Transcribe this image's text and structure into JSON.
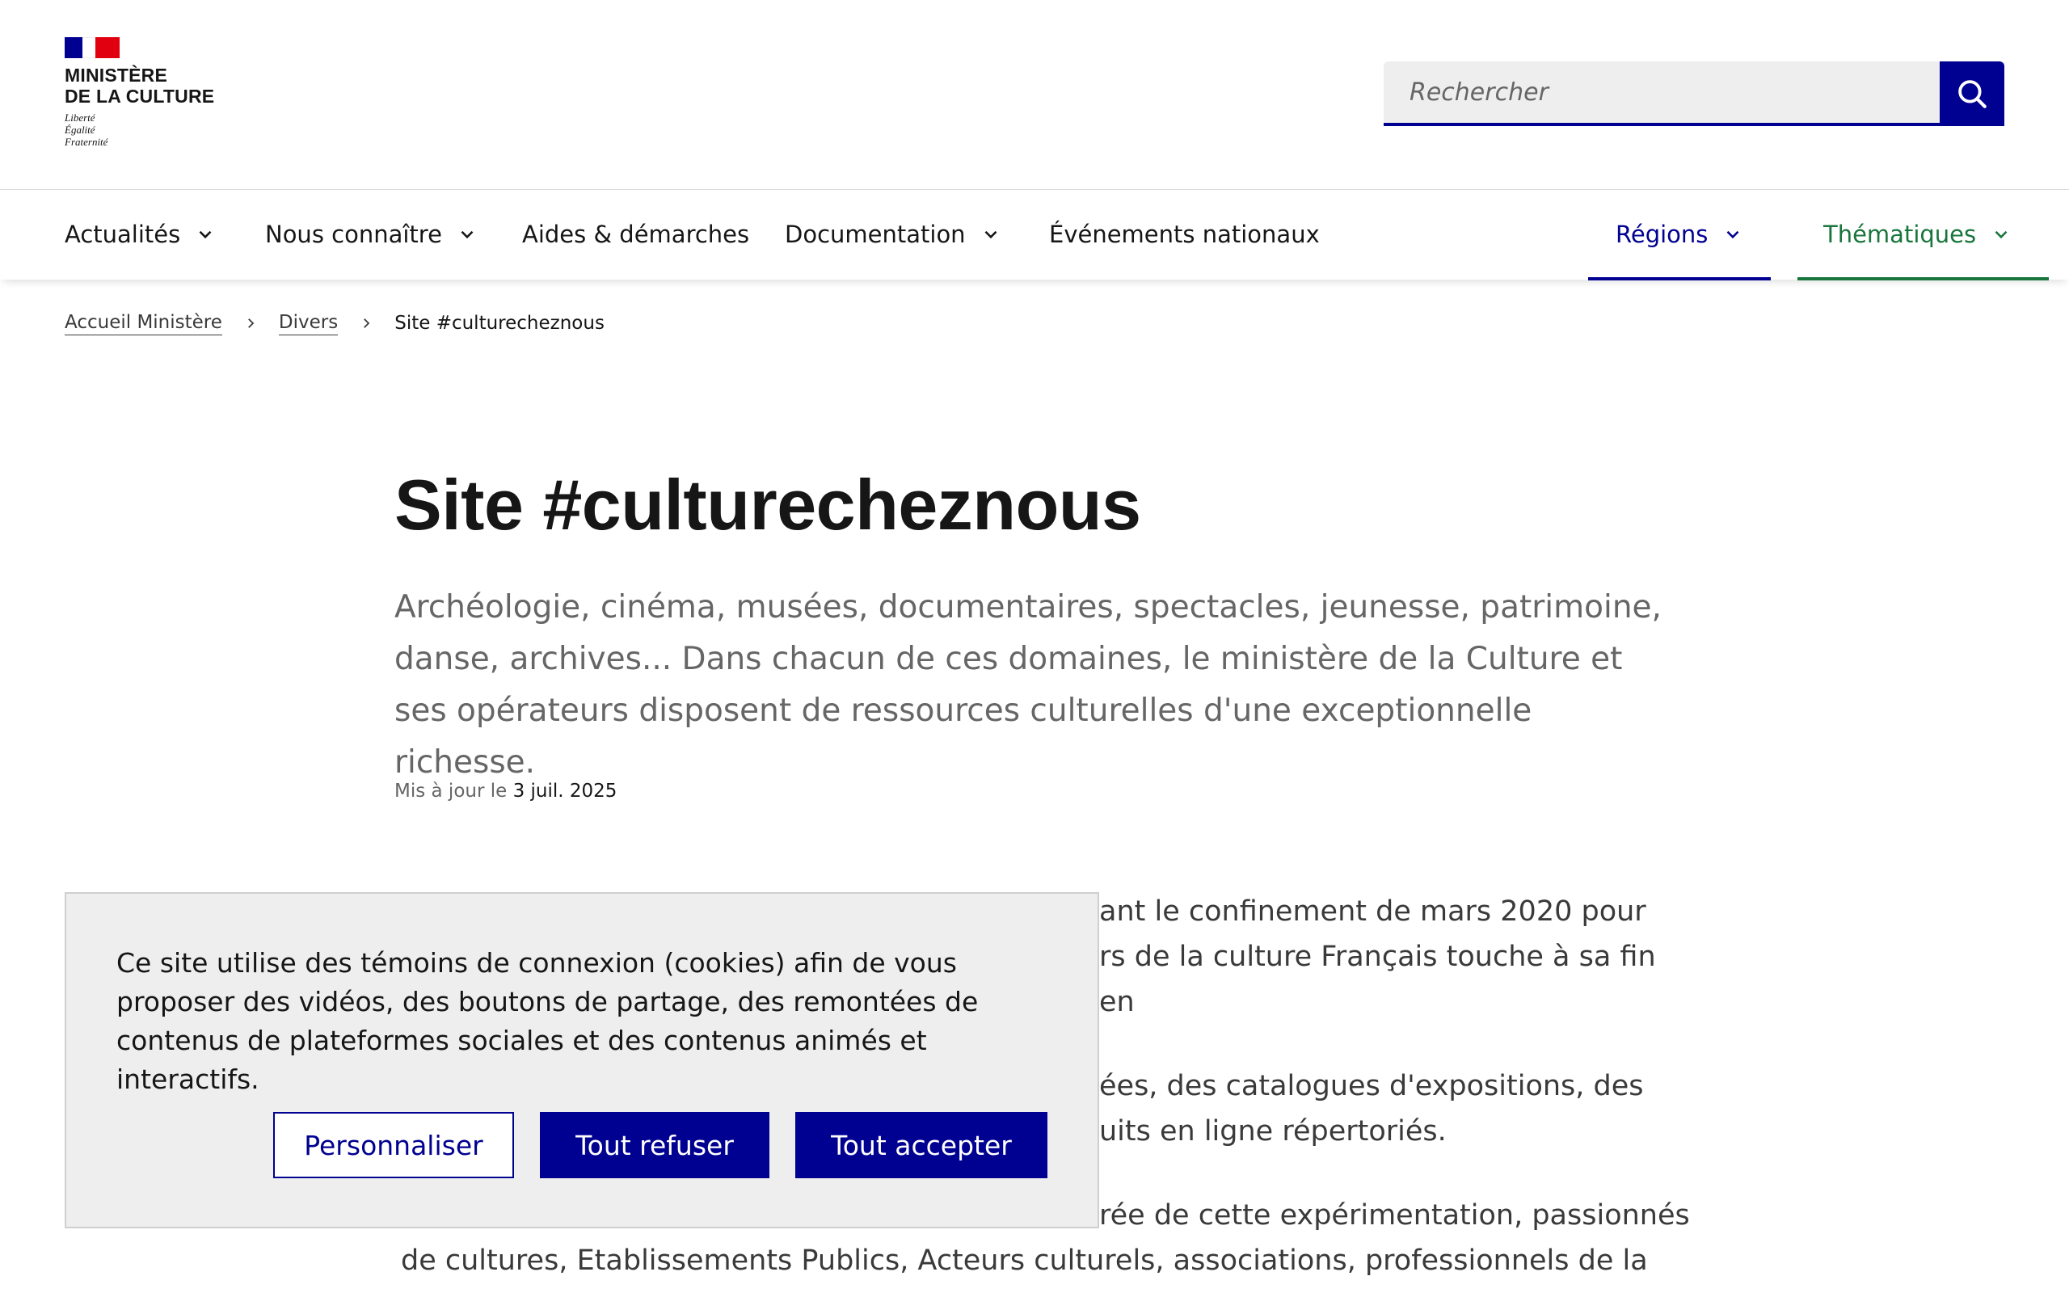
{
  "header": {
    "logo": {
      "ministry_line1": "Ministère",
      "ministry_line2": "de la Culture",
      "motto_1": "Liberté",
      "motto_2": "Égalité",
      "motto_3": "Fraternité"
    },
    "search": {
      "placeholder": "Rechercher",
      "button_icon": "search-icon"
    }
  },
  "nav": {
    "items": [
      {
        "label": "Actualités",
        "has_dropdown": true
      },
      {
        "label": "Nous connaître",
        "has_dropdown": true
      },
      {
        "label": "Aides & démarches",
        "has_dropdown": false
      },
      {
        "label": "Documentation",
        "has_dropdown": true
      },
      {
        "label": "Événements nationaux",
        "has_dropdown": false
      }
    ],
    "right_items": [
      {
        "label": "Régions",
        "has_dropdown": true,
        "color": "#000091"
      },
      {
        "label": "Thématiques",
        "has_dropdown": true,
        "color": "#18753c"
      }
    ]
  },
  "breadcrumb": {
    "items": [
      "Accueil Ministère",
      "Divers"
    ],
    "current": "Site #culturecheznous"
  },
  "main": {
    "title": "Site #culturecheznous",
    "lead": "Archéologie, cinéma, musées, documentaires, spectacles, jeunesse, patrimoine, danse, archives... Dans chacun de ces domaines, le ministère de la Culture et ses opérateurs disposent de ressources culturelles d'une exceptionnelle richesse.",
    "updated_prefix": "Mis à jour le",
    "updated_date": "3 juil. 2025",
    "paragraphs_visible_fragments": [
      "ant le confinement de mars 2020 pour",
      "rs de la culture Français touche à sa fin en",
      "ées, des catalogues d'expositions, des",
      "uits en ligne répertoriés.",
      "rée de cette expérimentation, passionnés",
      "de cultures, Etablissements Publics, Acteurs culturels, associations, professionnels de la"
    ]
  },
  "cookie_banner": {
    "message": "Ce site utilise des témoins de connexion (cookies) afin de vous proposer des vidéos, des boutons de partage, des remontées de contenus de plateformes sociales et des contenus animés et interactifs.",
    "buttons": {
      "customize": "Personnaliser",
      "refuse": "Tout refuser",
      "accept": "Tout accepter"
    }
  },
  "colors": {
    "brand_blue": "#000091",
    "marianne_red": "#e1000f",
    "thematiques_green": "#18753c",
    "banner_bg": "#eeeeee"
  }
}
